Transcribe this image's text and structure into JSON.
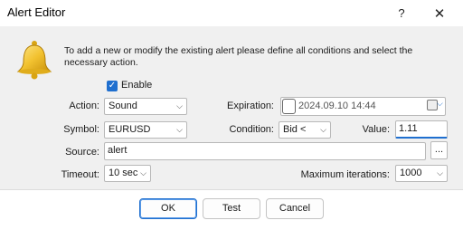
{
  "window": {
    "title": "Alert Editor",
    "help_glyph": "?",
    "close_glyph": "✕"
  },
  "info": {
    "text": "To add a new or modify the existing alert please define all conditions and select the necessary action."
  },
  "enable": {
    "label": "Enable",
    "checked": true,
    "check_glyph": "✓"
  },
  "fields": {
    "action_label": "Action:",
    "action_value": "Sound",
    "symbol_label": "Symbol:",
    "symbol_value": "EURUSD",
    "source_label": "Source:",
    "source_value": "alert",
    "source_button": "...",
    "timeout_label": "Timeout:",
    "timeout_value": "10 sec",
    "expiration_label": "Expiration:",
    "expiration_value": "2024.09.10 14:44",
    "condition_label": "Condition:",
    "condition_value": "Bid <",
    "value_label": "Value:",
    "value_value": "1.11",
    "max_iter_label": "Maximum iterations:",
    "max_iter_value": "1000"
  },
  "arrow_glyph": "⌵",
  "buttons": {
    "ok": "OK",
    "test": "Test",
    "cancel": "Cancel"
  },
  "colors": {
    "accent": "#1f6fcf",
    "panel": "#f0f0f0",
    "bell": "#f2c230"
  }
}
